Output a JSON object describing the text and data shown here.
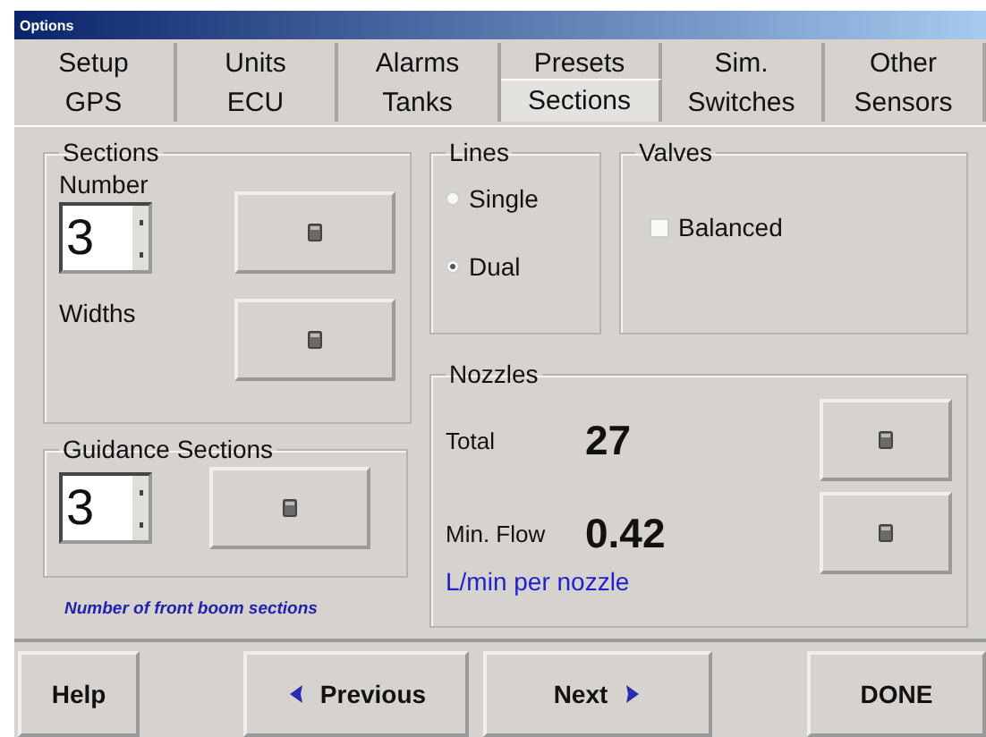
{
  "window": {
    "title": "Options"
  },
  "tab_rows": [
    [
      {
        "label": "Setup",
        "selected": false
      },
      {
        "label": "Units",
        "selected": false
      },
      {
        "label": "Alarms",
        "selected": false
      },
      {
        "label": "Presets",
        "selected": false
      },
      {
        "label": "Sim.",
        "selected": false
      },
      {
        "label": "Other",
        "selected": false
      }
    ],
    [
      {
        "label": "GPS",
        "selected": false
      },
      {
        "label": "ECU",
        "selected": false
      },
      {
        "label": "Tanks",
        "selected": false
      },
      {
        "label": "Sections",
        "selected": true
      },
      {
        "label": "Switches",
        "selected": false
      },
      {
        "label": "Sensors",
        "selected": false
      }
    ]
  ],
  "sections": {
    "title": "Sections",
    "number_label": "Number",
    "number_value": "3",
    "widths_label": "Widths"
  },
  "guidance": {
    "title": "Guidance Sections",
    "value": "3",
    "hint": "Number of front boom sections"
  },
  "lines": {
    "title": "Lines",
    "options": [
      {
        "label": "Single",
        "selected": false
      },
      {
        "label": "Dual",
        "selected": true
      }
    ]
  },
  "valves": {
    "title": "Valves",
    "options": [
      {
        "label": "Balanced",
        "checked": false
      }
    ]
  },
  "nozzles": {
    "title": "Nozzles",
    "rows": [
      {
        "label": "Total",
        "value": "27"
      },
      {
        "label": "Min. Flow",
        "value": "0.42"
      }
    ],
    "unit": "L/min per nozzle"
  },
  "buttons": [
    {
      "label": "Help",
      "kind": "plain"
    },
    {
      "label": "Previous",
      "kind": "back"
    },
    {
      "label": "Next",
      "kind": "forward"
    },
    {
      "label": "DONE",
      "kind": "plain"
    }
  ]
}
